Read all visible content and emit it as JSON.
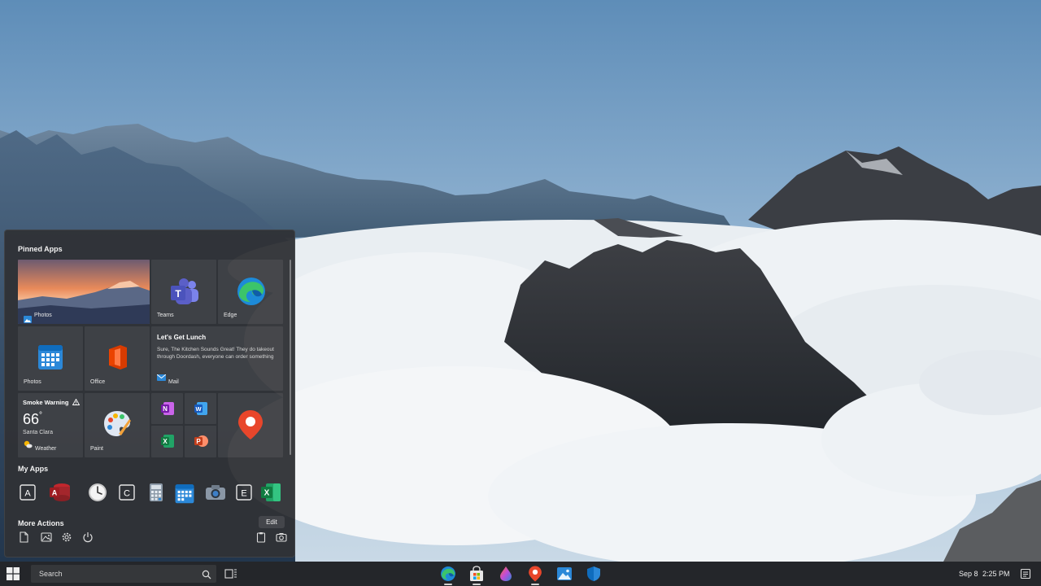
{
  "start_menu": {
    "pinned_title": "Pinned Apps",
    "pinned": {
      "photos_large": "Photos",
      "teams": "Teams",
      "edge": "Edge",
      "calendar_photos": "Photos",
      "office": "Office",
      "mail": {
        "title": "Let's Get Lunch",
        "body": "Sure, The Kitchen Sounds Great! They do takeout through Doordash, everyone can order something ...",
        "app": "Mail"
      },
      "weather": {
        "alert": "Smoke Warning",
        "temp": "66",
        "unit": "°",
        "location": "Santa Clara",
        "app": "Weather"
      },
      "paint": "Paint"
    },
    "myapps_title": "My Apps",
    "myapps": [
      {
        "icon": "a-letter-icon",
        "letter": "A"
      },
      {
        "icon": "access-icon",
        "letter": "A"
      },
      {
        "icon": "clock-icon"
      },
      {
        "icon": "c-letter-icon",
        "letter": "C"
      },
      {
        "icon": "calculator-icon"
      },
      {
        "icon": "calendar-icon"
      },
      {
        "icon": "camera-icon"
      },
      {
        "icon": "e-letter-icon",
        "letter": "E"
      },
      {
        "icon": "excel-icon",
        "letter": "X"
      }
    ],
    "more_actions_title": "More Actions",
    "edit_label": "Edit"
  },
  "taskbar": {
    "search_placeholder": "Search",
    "date": "Sep 8",
    "time": "2:25 PM"
  },
  "colors": {
    "accent_blue": "#0f6cbd",
    "teams": "#5b5fc7",
    "office_red": "#d83b01",
    "maps_red": "#e8462b",
    "excel_green": "#1d7a45"
  }
}
